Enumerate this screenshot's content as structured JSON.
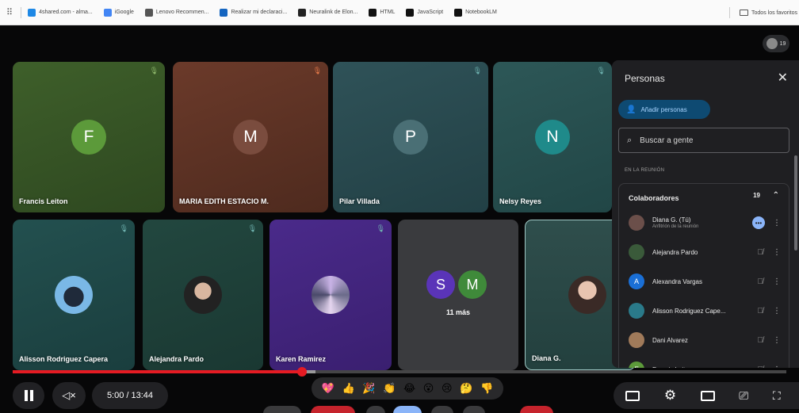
{
  "bookmarks": [
    {
      "label": "4shared.com - alma...",
      "icon": "4shared-icon",
      "color": "#1e88e5"
    },
    {
      "label": "iGoogle",
      "icon": "google-icon",
      "color": "#4285f4"
    },
    {
      "label": "Lenovo Recommen...",
      "icon": "folder-icon",
      "color": "#555555"
    },
    {
      "label": "Realizar mi declaraci...",
      "icon": "document-icon",
      "color": "#1565c0"
    },
    {
      "label": "Neuralink de Elon...",
      "icon": "neuralink-icon",
      "color": "#222222"
    },
    {
      "label": "HTML",
      "icon": "github-icon",
      "color": "#111111"
    },
    {
      "label": "JavaScript",
      "icon": "github-icon",
      "color": "#111111"
    },
    {
      "label": "NotebookLM",
      "icon": "notebooklm-icon",
      "color": "#111111"
    }
  ],
  "bookmarks_right": "Todos los favoritos",
  "self_view_count": "19",
  "tiles_top": [
    {
      "name": "Francis Leiton",
      "initial": "F",
      "bg": "#3e5f2a",
      "bg2": "#2e4820",
      "circle": "#5c9a3a",
      "mic": "#8fb86c"
    },
    {
      "name": "MARIA EDITH ESTACIO M.",
      "initial": "M",
      "bg": "#6b3a2a",
      "bg2": "#4e2a1e",
      "circle": "#7a4c3e",
      "mic": "#e57a4a"
    },
    {
      "name": "Pilar Villada",
      "initial": "P",
      "bg": "#2f5258",
      "bg2": "#224045",
      "circle": "#4a6f75",
      "mic": "#6fb3b0"
    },
    {
      "name": "Nelsy Reyes",
      "initial": "N",
      "bg": "#2d5757",
      "bg2": "#214646",
      "circle": "#1f8a8a",
      "mic": "#6fb3b0"
    }
  ],
  "tiles_bottom": [
    {
      "name": "Alisson Rodriguez Capera",
      "bg": "#23504f",
      "bg2": "#1a3e3e",
      "photo": "orca-avatar"
    },
    {
      "name": "Alejandra Pardo",
      "bg": "#22473f",
      "bg2": "#1a3832",
      "photo": "woman-avatar"
    },
    {
      "name": "Karen Ramirez",
      "bg": "#4a2a8a",
      "bg2": "#3a1f70",
      "photo": "collage-avatar"
    }
  ],
  "more_tile": {
    "initials": [
      "S",
      "M"
    ],
    "colors": [
      "#5a34b8",
      "#3f8a3a"
    ],
    "label": "11 más"
  },
  "self_tile": {
    "name": "Diana G."
  },
  "panel": {
    "title": "Personas",
    "add_label": "Añadir personas",
    "search_placeholder": "Buscar a gente",
    "section": "EN LA REUNIÓN",
    "group_label": "Colaboradores",
    "group_count": "19",
    "members": [
      {
        "name": "Diana G. (Tú)",
        "sub": "Anfitrión de la reunión",
        "avatar": "photo",
        "color": "#6b4f4a",
        "host": true
      },
      {
        "name": "Alejandra Pardo",
        "sub": "",
        "avatar": "photo",
        "color": "#3a5a3a",
        "host": false
      },
      {
        "name": "Alexandra Vargas",
        "sub": "",
        "avatar": "A",
        "color": "#1a6fd6",
        "host": false
      },
      {
        "name": "Alisson Rodriguez Cape...",
        "sub": "",
        "avatar": "photo",
        "color": "#2a7a8a",
        "host": false
      },
      {
        "name": "Dani Alvarez",
        "sub": "",
        "avatar": "photo",
        "color": "#a07a5a",
        "host": false
      },
      {
        "name": "Francis Leiton",
        "sub": "",
        "avatar": "F",
        "color": "#5c9a3a",
        "host": false
      }
    ]
  },
  "player": {
    "time": "5:00 / 13:44",
    "progress": 0.374,
    "buffered": 0.391
  },
  "reactions": [
    "💖",
    "👍",
    "🎉",
    "👏",
    "😂",
    "😮",
    "😢",
    "🤔",
    "👎"
  ]
}
